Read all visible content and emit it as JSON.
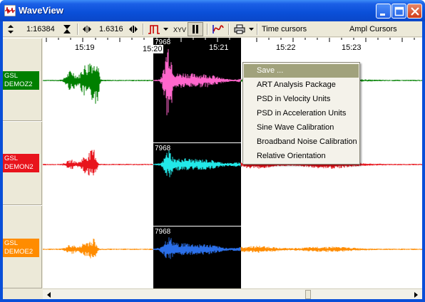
{
  "window": {
    "title": "WaveView",
    "controls": {
      "minimize": "minimize-icon",
      "maximize": "maximize-icon",
      "close": "close-icon"
    }
  },
  "toolbar": {
    "time_scale": "1:16384",
    "ampl_scale": "1.6316",
    "time_cursors_label": "Time cursors",
    "ampl_cursors_label": "Ampl Cursors",
    "icons": [
      "updown-arrows-icon",
      "zoom-hourglass-icon",
      "left-right-arrows-icon",
      "step-right-icon",
      "pulse-filter-icon",
      "dropdown-arrow-icon",
      "xyz-axis-icon",
      "pause-icon",
      "spectrum-icon",
      "printer-icon",
      "dropdown-arrow-icon"
    ]
  },
  "time_axis": {
    "ticks": [
      "15:19",
      "15:20",
      "15:21",
      "15:22",
      "15:23"
    ]
  },
  "selection": {
    "sample_labels": [
      "7968",
      "7968",
      "7968"
    ]
  },
  "channels": [
    {
      "network": "GSL",
      "station": "DEMOZ2",
      "color": "#008000",
      "label_bg": "#008000",
      "selected_color": "#ff66cc"
    },
    {
      "network": "GSL",
      "station": "DEMON2",
      "color": "#e8141c",
      "label_bg": "#e8141c",
      "selected_color": "#22e8e8"
    },
    {
      "network": "GSL",
      "station": "DEMOE2",
      "color": "#ff8c00",
      "label_bg": "#ff8c00",
      "selected_color": "#2b6fe8"
    }
  ],
  "context_menu": {
    "items": [
      "Save ...",
      "ART Analysis Package",
      "PSD in Velocity Units",
      "PSD in Acceleration Units",
      "Sine Wave Calibration",
      "Broadband Noise Calibration",
      "Relative Orientation"
    ],
    "highlighted_index": 0
  },
  "colors": {
    "title_bar": "#0a4fd8",
    "face": "#ece9d8",
    "menu_highlight": "#a1a27c",
    "selection_bg": "#000000"
  }
}
